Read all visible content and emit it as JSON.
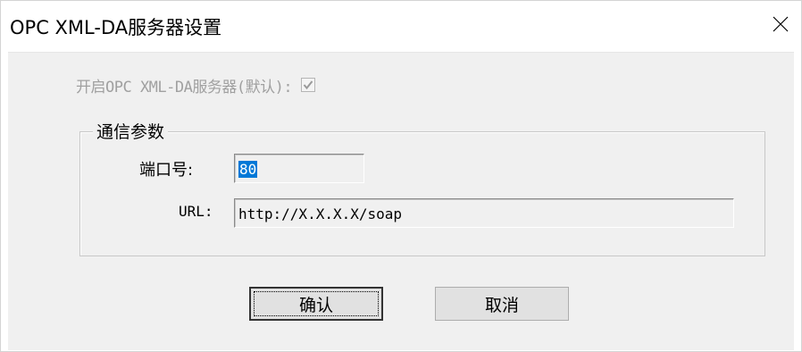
{
  "window": {
    "title": "OPC XML-DA服务器设置",
    "close_icon": "close-icon"
  },
  "server": {
    "label": "开启OPC XML-DA服务器(默认):",
    "enabled": true
  },
  "comm_group": {
    "legend": "通信参数",
    "port": {
      "label": "端口号:",
      "value": "80"
    },
    "url": {
      "label": "URL:",
      "value": "http://X.X.X.X/soap"
    }
  },
  "buttons": {
    "ok_label": "确认",
    "cancel_label": "取消"
  },
  "colors": {
    "selection": "#0078d7",
    "disabled_text": "#a0a0a0",
    "dialog_background": "#f0f0f0"
  }
}
